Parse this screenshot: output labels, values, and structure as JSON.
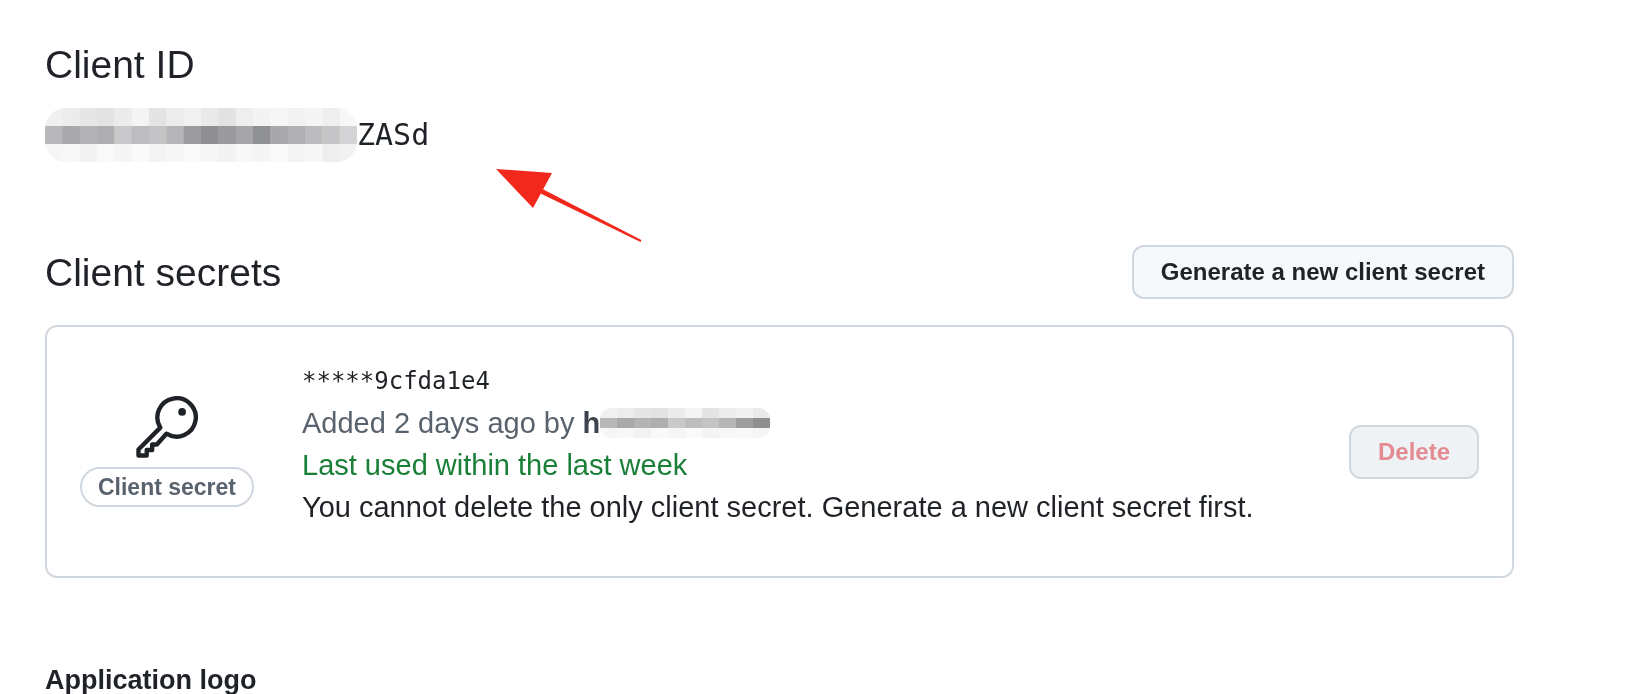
{
  "client_id": {
    "heading": "Client ID",
    "value_visible_end": "ZASd"
  },
  "client_secrets": {
    "heading": "Client secrets",
    "generate_button": {
      "label": "Generate a new client secret"
    },
    "secrets": [
      {
        "badge": "Client secret",
        "masked_value": "*****9cfda1e4",
        "added": "Added 2 days ago by **h**",
        "last_used": "Last used within the last week",
        "note": "You cannot delete the only client secret. Generate a new client secret first.",
        "delete_button": {
          "label": "Delete",
          "disabled": true
        }
      }
    ]
  },
  "application_logo": {
    "heading": "Application logo"
  }
}
